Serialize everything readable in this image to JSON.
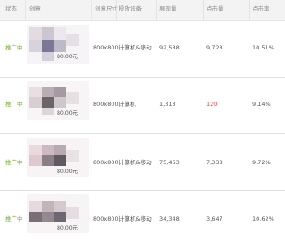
{
  "table": {
    "headers": {
      "status": "状态",
      "creative": "创意",
      "size": "创意尺寸",
      "device": "投放设备",
      "impressions": "展现量",
      "clicks": "点击量",
      "ctr": "点击率"
    },
    "rows": [
      {
        "status": "推广中",
        "price": "80.00元",
        "size": "800x800",
        "device": "计算机&移动",
        "impressions": "92,588",
        "clicks": "9,728",
        "ctr": "10.51%",
        "clicks_highlight": false
      },
      {
        "status": "推广中",
        "price": "80.00元",
        "size": "800x800",
        "device": "计算机",
        "impressions": "1,313",
        "clicks": "120",
        "ctr": "9.14%",
        "clicks_highlight": true
      },
      {
        "status": "推广中",
        "price": "80.00元",
        "size": "800x800",
        "device": "计算机&移动",
        "impressions": "75,463",
        "clicks": "7,338",
        "ctr": "9.72%",
        "clicks_highlight": false
      },
      {
        "status": "推广中",
        "price": "80.00元",
        "size": "800x800",
        "device": "计算机&移动",
        "impressions": "34,348",
        "clicks": "3,647",
        "ctr": "10.62%",
        "clicks_highlight": false
      }
    ]
  },
  "colors": {
    "status_active": "#7ab13a",
    "clicks_alert": "#e0433b",
    "header_bg": "#f3f3f3"
  }
}
